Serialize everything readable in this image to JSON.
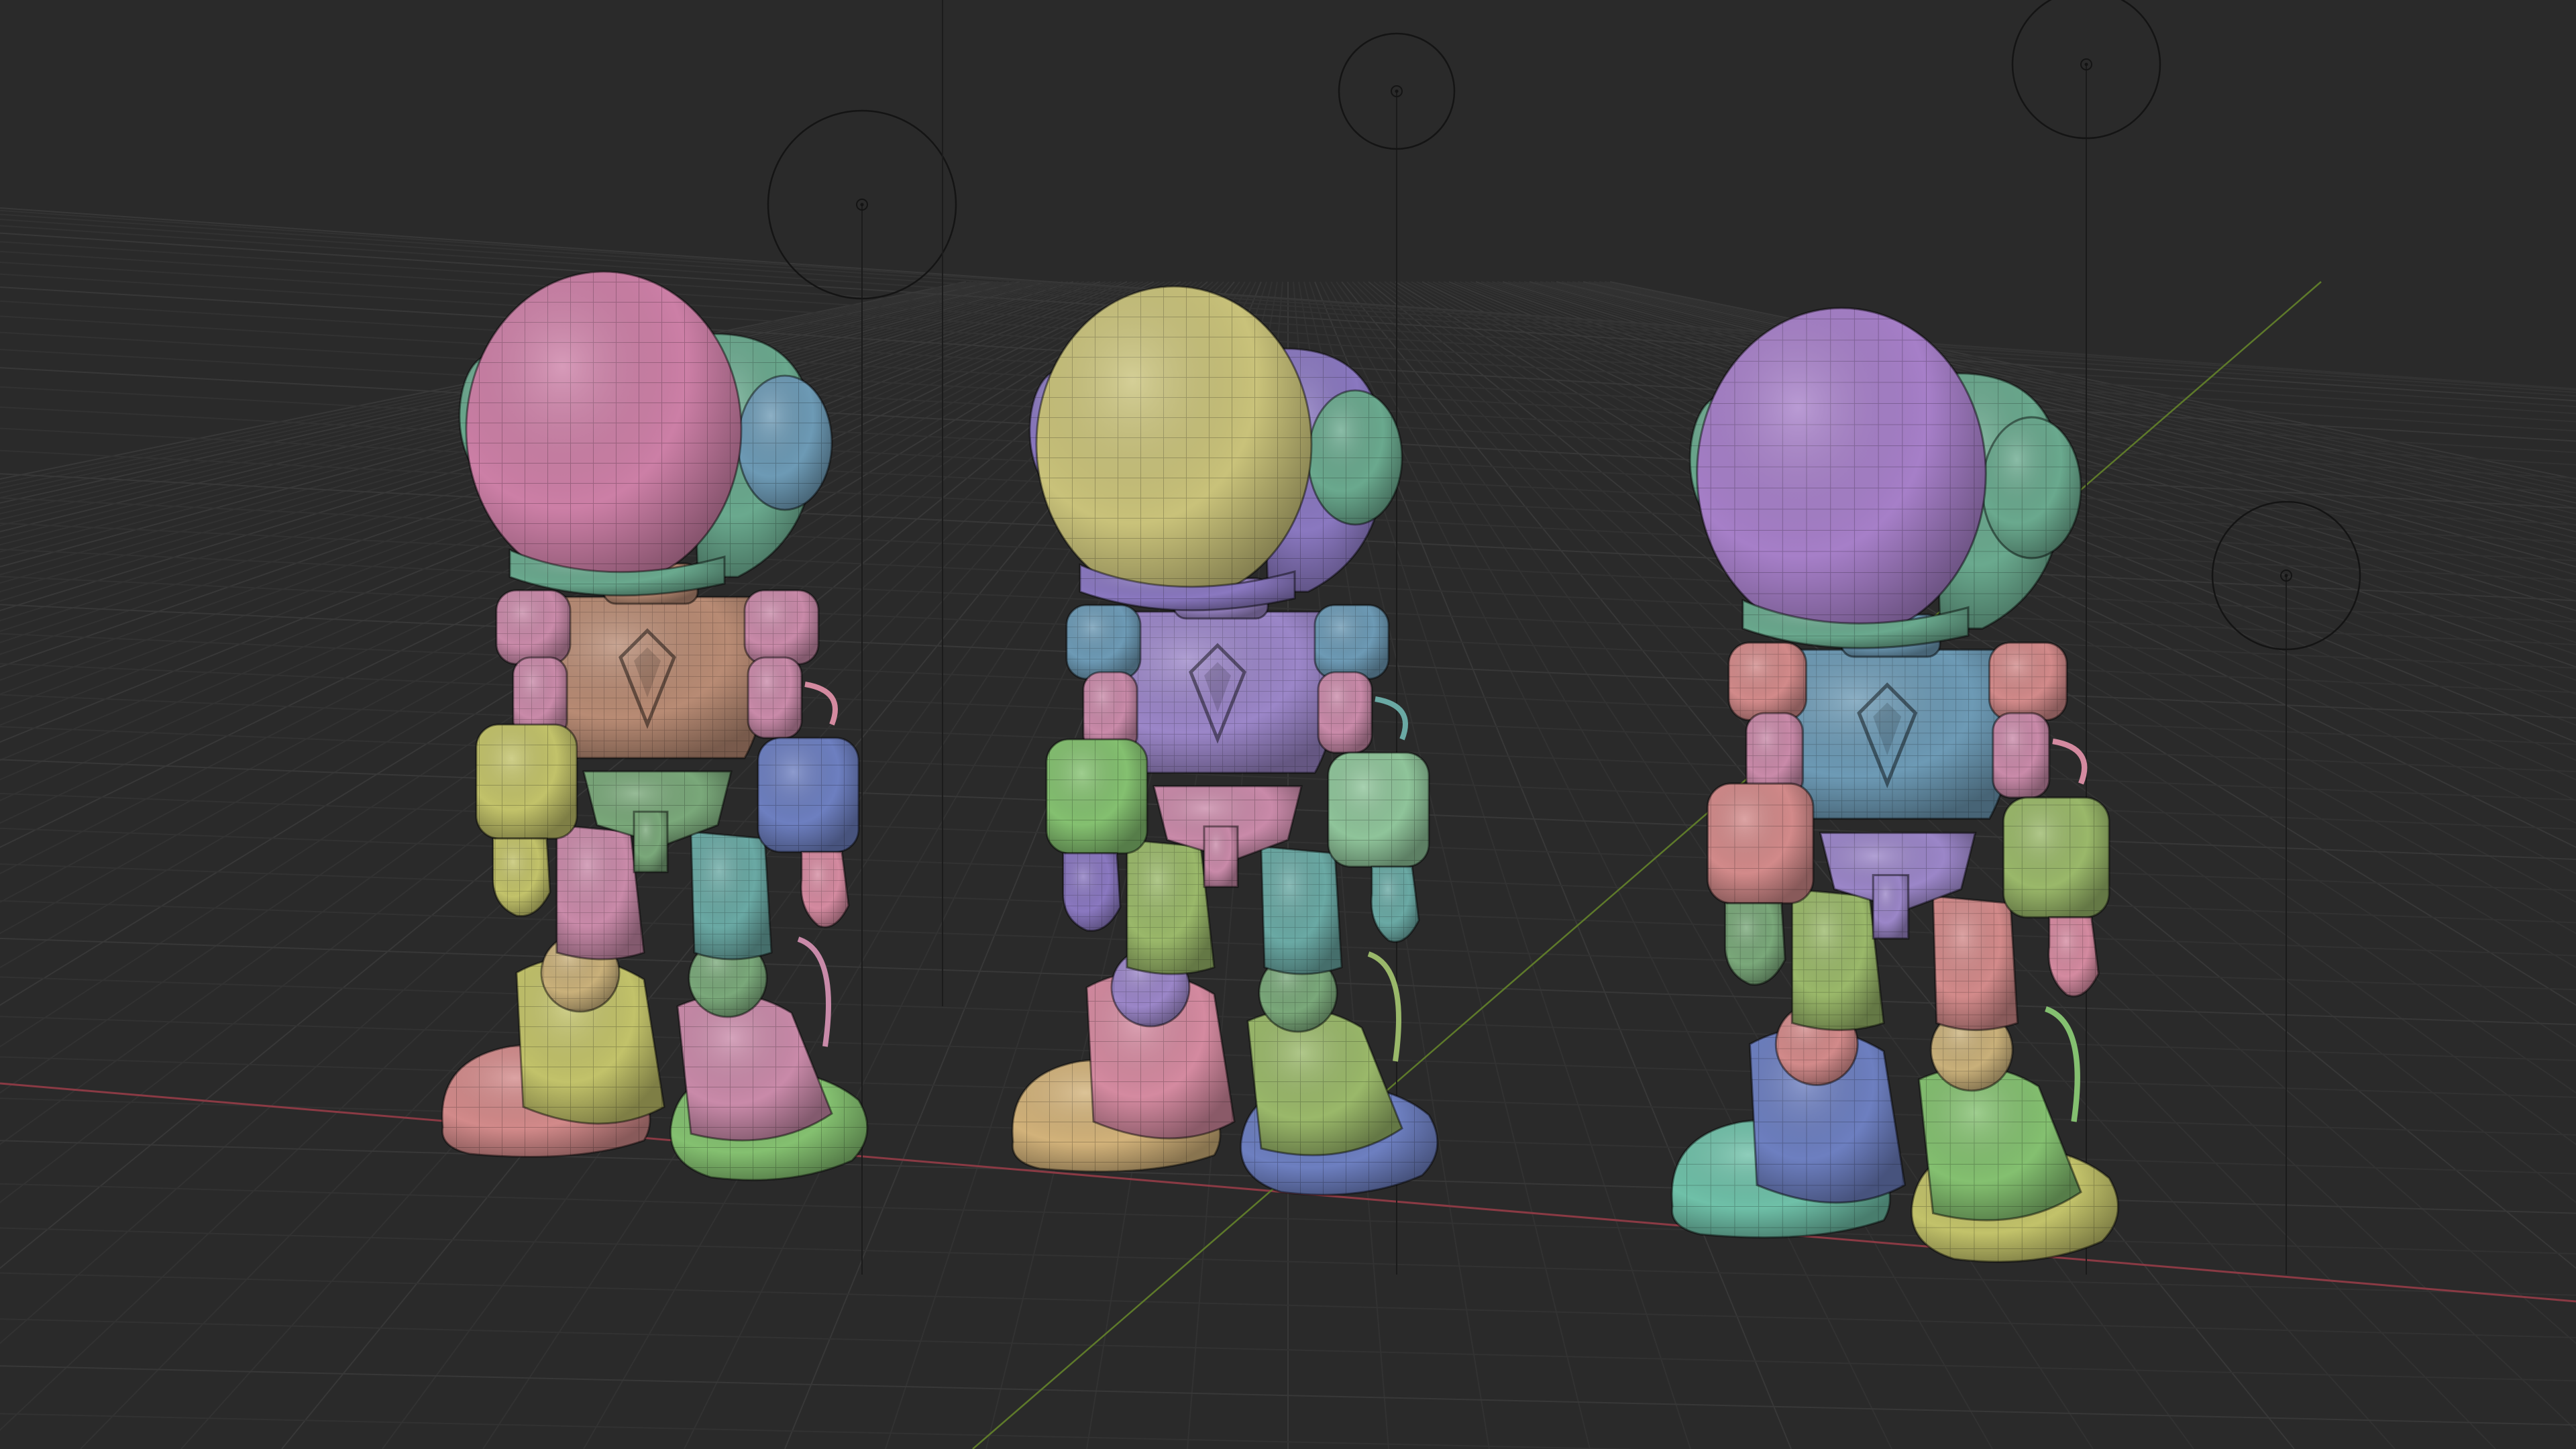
{
  "viewport": {
    "name": "3D Viewport",
    "background": "#2a2a2a",
    "grid": {
      "visible": true,
      "minor_color": "#323232",
      "major_color": "#383838"
    },
    "axes": {
      "x_color": "#8a3a44",
      "y_color": "#5e7a2a"
    },
    "lights": {
      "count": 4,
      "icon": "light-icon"
    }
  },
  "robots": [
    {
      "name": "robot-pink-helmet",
      "colors": {
        "helmet": "#cc7fa6",
        "visor": "#6aa98e",
        "ear": "#6d9ab5",
        "torso": "#b88b74",
        "shoulder": "#c98aa9",
        "arm_upper": "#c98aa9",
        "arm_lower_left": "#c2c26a",
        "arm_lower_right": "#6d7fc0",
        "hand_left": "#c2c26a",
        "hand_right": "#d48aa0",
        "pelvis": "#7aa87a",
        "thigh_left": "#c98aa9",
        "thigh_right": "#6aa9a4",
        "knee_left": "#c9b07a",
        "knee_right": "#7aa87a",
        "shin_left": "#c2c26a",
        "shin_right": "#c98aa9",
        "foot_left": "#d28a8a",
        "foot_right": "#84c070"
      }
    },
    {
      "name": "robot-yellow-helmet",
      "colors": {
        "helmet": "#c9c27a",
        "visor": "#8a78c0",
        "ear": "#6aa98e",
        "torso": "#9b86c8",
        "shoulder": "#6d9ab5",
        "arm_upper": "#c98aa9",
        "arm_lower_left": "#84c070",
        "arm_lower_right": "#8fc49a",
        "hand_left": "#8a78c0",
        "hand_right": "#6aa9a4",
        "pelvis": "#c98aa9",
        "thigh_left": "#9ab86a",
        "thigh_right": "#6aa9a4",
        "knee_left": "#9b86c8",
        "knee_right": "#7aa87a",
        "shin_left": "#d48aa0",
        "shin_right": "#9ab86a",
        "foot_left": "#d2b27a",
        "foot_right": "#6d7fc0"
      }
    },
    {
      "name": "robot-purple-helmet",
      "colors": {
        "helmet": "#a67fc8",
        "visor": "#6aa98e",
        "ear": "#6aa98e",
        "torso": "#6d9ab5",
        "shoulder": "#d28a8a",
        "arm_upper": "#c98aa9",
        "arm_lower_left": "#d28a8a",
        "arm_lower_right": "#9ab86a",
        "hand_left": "#7aa87a",
        "hand_right": "#d48aa0",
        "pelvis": "#9b86c8",
        "thigh_left": "#9ab86a",
        "thigh_right": "#d28a8a",
        "knee_left": "#d28a8a",
        "knee_right": "#c9b07a",
        "shin_left": "#6d7fc0",
        "shin_right": "#84c070",
        "foot_left": "#6fc0a8",
        "foot_right": "#c2c26a"
      }
    }
  ]
}
